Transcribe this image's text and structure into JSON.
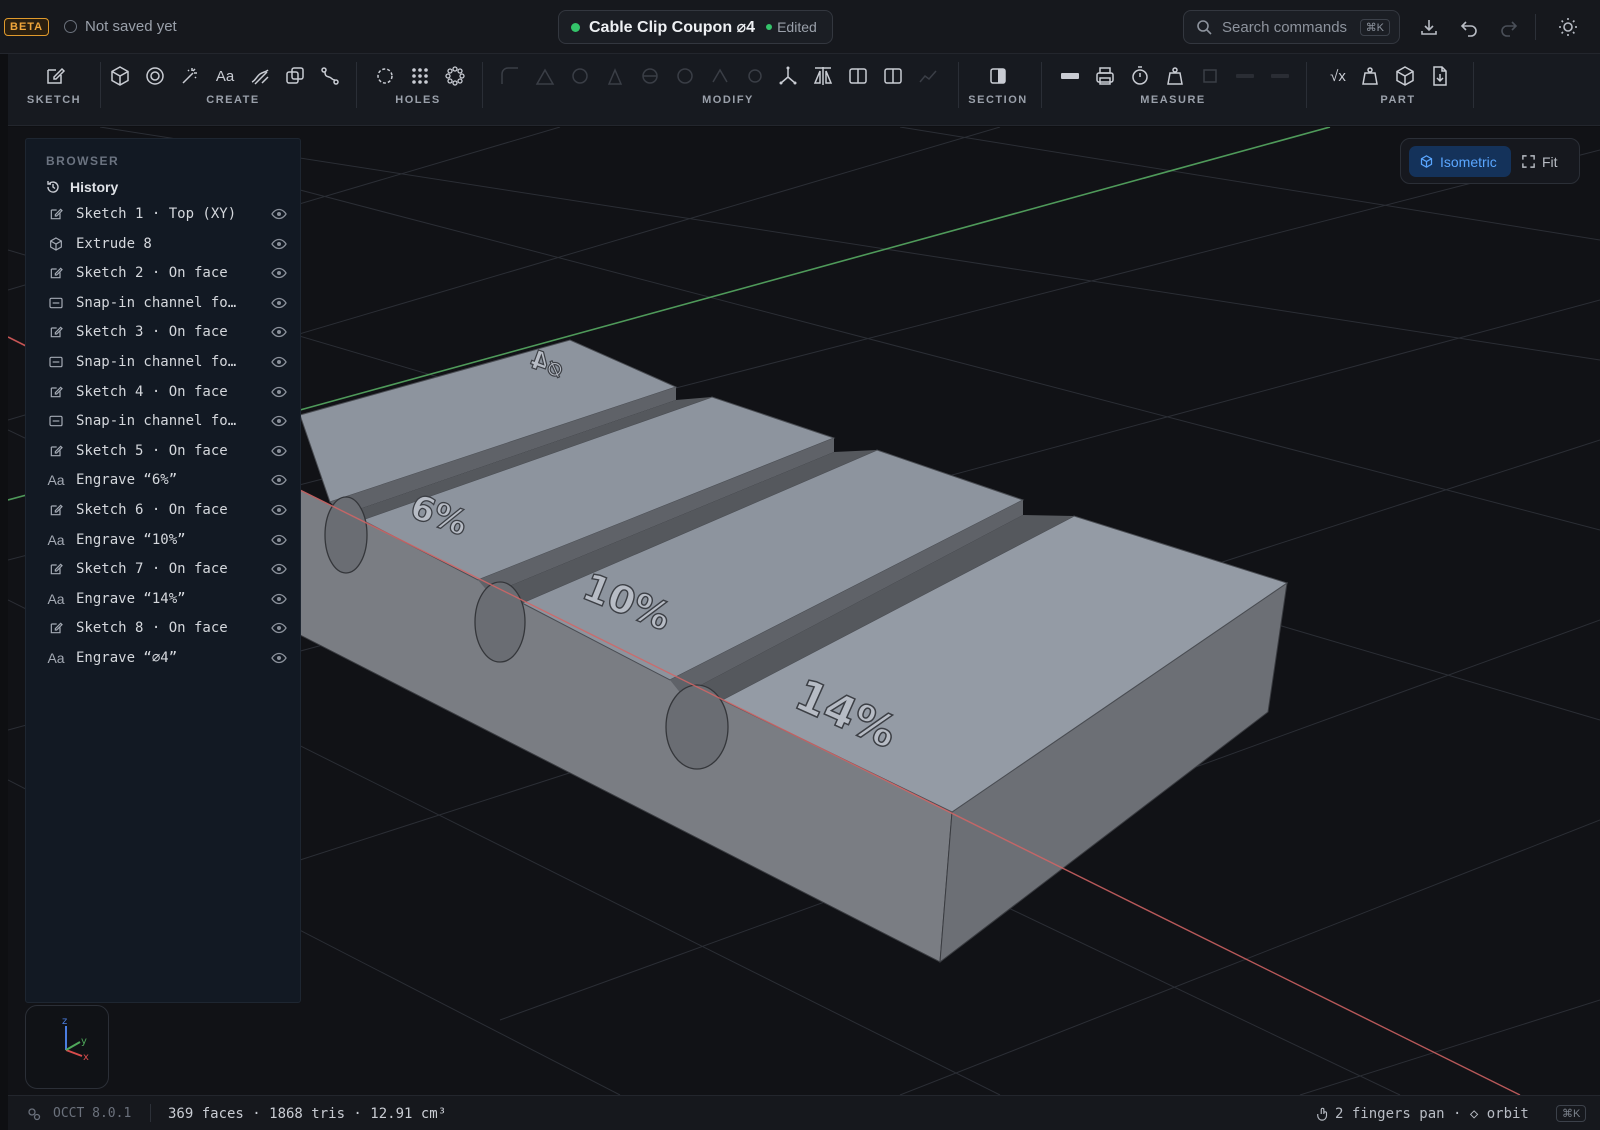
{
  "header": {
    "beta_badge": "BETA",
    "save_status": "Not saved yet",
    "document_title": "Cable Clip Coupon ⌀4",
    "edited_label": "Edited",
    "search_placeholder": "Search commands",
    "search_shortcut": "⌘K",
    "status_color": "#34c46a",
    "icons": [
      "download-icon",
      "undo-icon",
      "redo-icon",
      "theme-sun-icon"
    ]
  },
  "ribbon": {
    "groups": [
      {
        "label": "SKETCH"
      },
      {
        "label": "CREATE"
      },
      {
        "label": "HOLES"
      },
      {
        "label": "MODIFY"
      },
      {
        "label": "SECTION"
      },
      {
        "label": "MEASURE"
      },
      {
        "label": "PART"
      }
    ],
    "text_tool_glyph": "Aa",
    "formula_glyph": "√x"
  },
  "view_controls": {
    "isometric_label": "Isometric",
    "fit_label": "Fit",
    "accent_color": "#5aa6ff"
  },
  "browser": {
    "title": "BROWSER",
    "history_label": "History",
    "items": [
      {
        "icon": "sketch-icon",
        "label": "Sketch 1 · Top (XY)"
      },
      {
        "icon": "extrude-cube-icon",
        "label": "Extrude 8"
      },
      {
        "icon": "sketch-icon",
        "label": "Sketch 2 · On face"
      },
      {
        "icon": "cut-channel-icon",
        "label": "Snap-in channel fo…"
      },
      {
        "icon": "sketch-icon",
        "label": "Sketch 3 · On face"
      },
      {
        "icon": "cut-channel-icon",
        "label": "Snap-in channel fo…"
      },
      {
        "icon": "sketch-icon",
        "label": "Sketch 4 · On face"
      },
      {
        "icon": "cut-channel-icon",
        "label": "Snap-in channel fo…"
      },
      {
        "icon": "sketch-icon",
        "label": "Sketch 5 · On face"
      },
      {
        "icon": "engrave-text-icon",
        "label": "Engrave “6%”"
      },
      {
        "icon": "sketch-icon",
        "label": "Sketch 6 · On face"
      },
      {
        "icon": "engrave-text-icon",
        "label": "Engrave “10%”"
      },
      {
        "icon": "sketch-icon",
        "label": "Sketch 7 · On face"
      },
      {
        "icon": "engrave-text-icon",
        "label": "Engrave “14%”"
      },
      {
        "icon": "sketch-icon",
        "label": "Sketch 8 · On face"
      },
      {
        "icon": "engrave-text-icon",
        "label": "Engrave “⌀4”"
      }
    ]
  },
  "model": {
    "engravings": [
      "⌀4",
      "6%",
      "10%",
      "14%"
    ]
  },
  "axis_widget": {
    "x": "x",
    "y": "y",
    "z": "z"
  },
  "statusbar": {
    "kernel": "OCCT 8.0.1",
    "stats": "369 faces · 1868 tris · 12.91 cm³",
    "hint": "2 fingers pan · ◇ orbit",
    "shortcut": "⌘K"
  }
}
